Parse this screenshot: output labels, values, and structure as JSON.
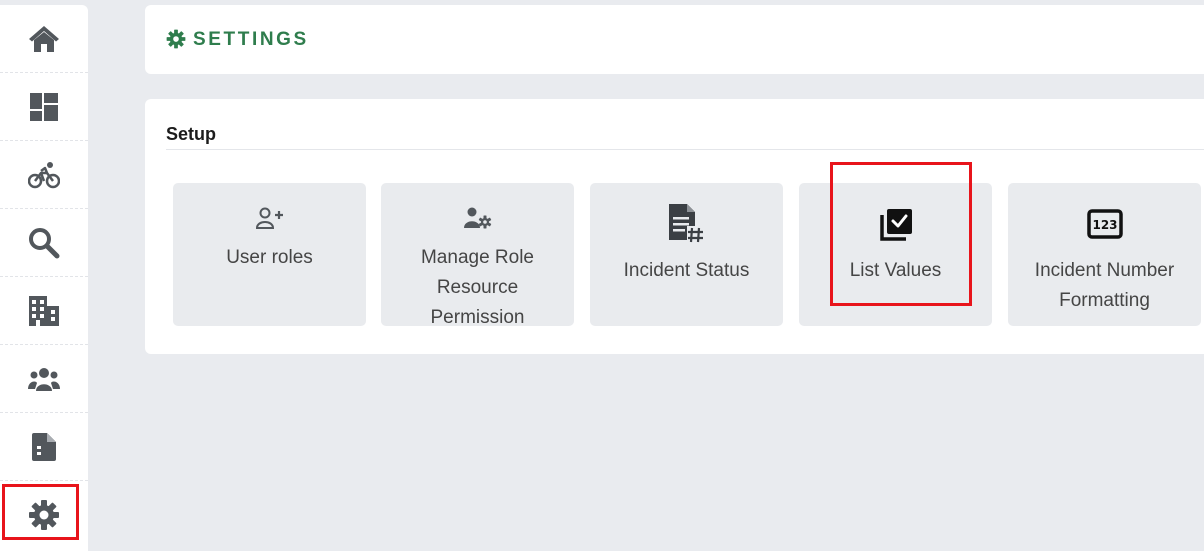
{
  "header": {
    "title": "SETTINGS",
    "icon": "gear-icon",
    "accent_color": "#2f7d4d"
  },
  "sidebar": {
    "items": [
      {
        "id": "home",
        "icon": "home-icon"
      },
      {
        "id": "dashboard",
        "icon": "dashboard-icon"
      },
      {
        "id": "activity",
        "icon": "bicycle-icon"
      },
      {
        "id": "search",
        "icon": "search-icon"
      },
      {
        "id": "buildings",
        "icon": "building-icon"
      },
      {
        "id": "teams",
        "icon": "users-icon"
      },
      {
        "id": "reports",
        "icon": "file-icon"
      },
      {
        "id": "settings",
        "icon": "gear-icon",
        "selected": true
      }
    ]
  },
  "setup": {
    "section_title": "Setup",
    "tiles": [
      {
        "label_lines": [
          "User roles"
        ],
        "icon": "user-plus-icon"
      },
      {
        "label_lines": [
          "Manage Role",
          "Resource",
          "Permission"
        ],
        "icon": "user-gear-icon"
      },
      {
        "label_lines": [
          "Incident Status"
        ],
        "icon": "document-hash-icon"
      },
      {
        "label_lines": [
          "List Values"
        ],
        "icon": "checklist-icon",
        "highlighted": true
      },
      {
        "label_lines": [
          "Incident Number",
          "Formatting"
        ],
        "icon": "number-123-icon"
      }
    ]
  },
  "colors": {
    "highlight": "#e8141b",
    "icon": "#52575c",
    "tile_bg": "#e9ebee"
  }
}
